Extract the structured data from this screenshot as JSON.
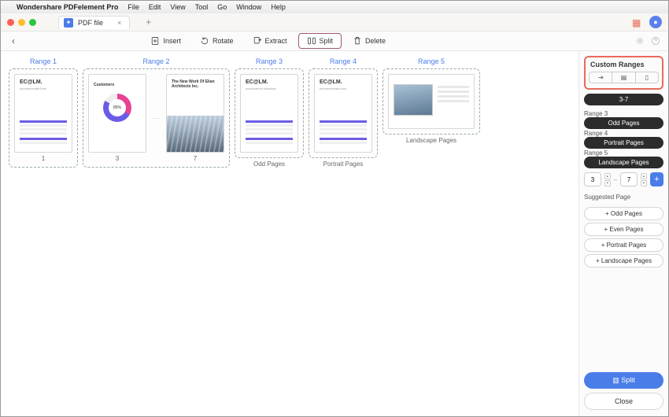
{
  "menubar": {
    "app": "Wondershare PDFelement Pro",
    "items": [
      "File",
      "Edit",
      "View",
      "Tool",
      "Go",
      "Window",
      "Help"
    ]
  },
  "tab": {
    "title": "PDF file"
  },
  "toolbar": {
    "insert": "Insert",
    "rotate": "Rotate",
    "extract": "Extract",
    "split": "Split",
    "delete": "Delete"
  },
  "ranges": [
    {
      "title": "Range 1",
      "caption": "",
      "pages": [
        {
          "label": "1",
          "kind": "invoice",
          "hdr": "EC@LM.",
          "sub": "ecomercemak hors"
        }
      ]
    },
    {
      "title": "Range 2",
      "caption": "",
      "pages": [
        {
          "label": "3",
          "kind": "donut",
          "hdr": "Customers"
        },
        {
          "label": "7",
          "kind": "building",
          "hdr": "The New Work Of Elian Architects Inc."
        }
      ],
      "ellipsis": true
    },
    {
      "title": "Range 3",
      "caption": "Odd Pages",
      "pages": [
        {
          "label": "",
          "kind": "invoice",
          "hdr": "EC@LM.",
          "sub": "ecocomerce solutions"
        }
      ]
    },
    {
      "title": "Range 4",
      "caption": "Portrait Pages",
      "pages": [
        {
          "label": "",
          "kind": "invoice",
          "hdr": "EC@LM.",
          "sub": "ecomercemak hors"
        }
      ]
    },
    {
      "title": "Range 5",
      "caption": "Landscape Pages",
      "pages": [
        {
          "label": "",
          "kind": "landscape"
        }
      ]
    }
  ],
  "sidebar": {
    "title": "Custom Ranges",
    "active_range": "3-7",
    "existing": [
      {
        "label": "Range 3",
        "value": "Odd Pages"
      },
      {
        "label": "Range 4",
        "value": "Portrait Pages"
      },
      {
        "label": "Range 5",
        "value": "Landscape Pages"
      }
    ],
    "from": "3",
    "to": "7",
    "suggested_title": "Suggested Page",
    "suggested": [
      "Odd Pages",
      "Even Pages",
      "Portrait Pages",
      "Landscape Pages"
    ],
    "split_btn": "Split",
    "close_btn": "Close"
  }
}
